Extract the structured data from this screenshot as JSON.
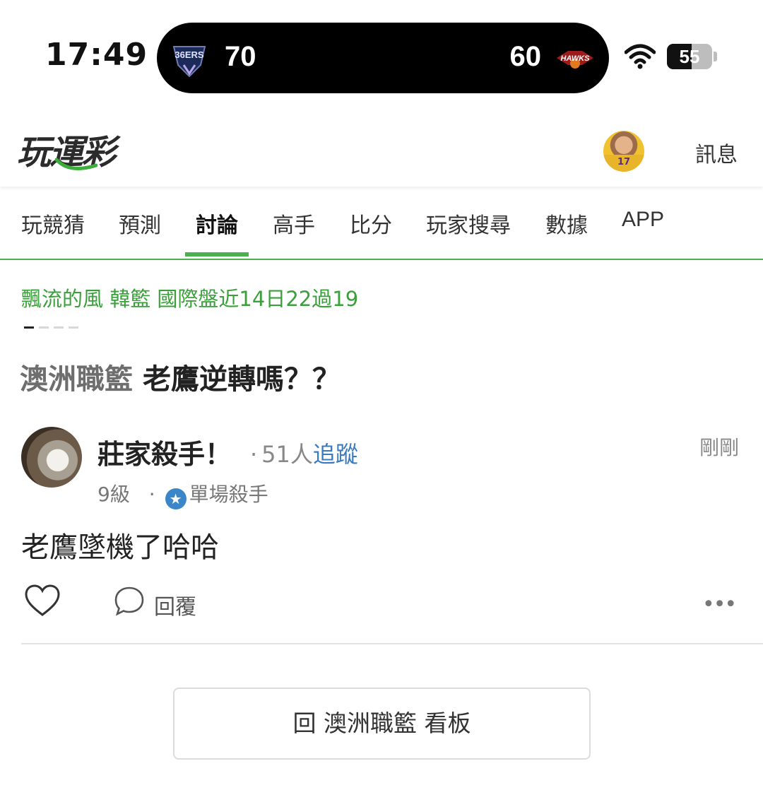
{
  "status_bar": {
    "time": "17:49",
    "live_score": {
      "home_logo_text": "36ERS",
      "home_score": "70",
      "away_score": "60",
      "away_logo_text": "HAWKS"
    },
    "battery_level": "55",
    "battery_fraction": 0.55
  },
  "header": {
    "logo_text": "玩運彩",
    "avatar_jersey": "17",
    "messages_label": "訊息"
  },
  "nav": {
    "tabs": [
      {
        "label": "玩競猜",
        "active": false
      },
      {
        "label": "預測",
        "active": false
      },
      {
        "label": "討論",
        "active": true
      },
      {
        "label": "高手",
        "active": false
      },
      {
        "label": "比分",
        "active": false
      },
      {
        "label": "玩家搜尋",
        "active": false
      },
      {
        "label": "數據",
        "active": false
      },
      {
        "label": "APP",
        "active": false
      }
    ]
  },
  "ticker": {
    "text": "飄流的風 韓籃 國際盤近14日22過19",
    "active_index": 0,
    "count": 4
  },
  "post": {
    "board": "澳洲職籃",
    "subject": "老鷹逆轉嗎？？",
    "author": {
      "name": "莊家殺手！",
      "followers_prefix": "·",
      "followers": "51人",
      "follow_label": "追蹤",
      "level": "9級",
      "badge_separator": "·",
      "badge_label": "單場殺手"
    },
    "time": "剛剛",
    "body": "老鷹墜機了哈哈",
    "reply_label": "回覆",
    "more_label": "•••"
  },
  "back_button": {
    "label": "回 澳洲職籃 看板"
  },
  "colors": {
    "accent_green": "#4caf50",
    "ticker_green": "#3aa03a",
    "follow_blue": "#3a7bbf",
    "badge_blue": "#3b86c9"
  }
}
